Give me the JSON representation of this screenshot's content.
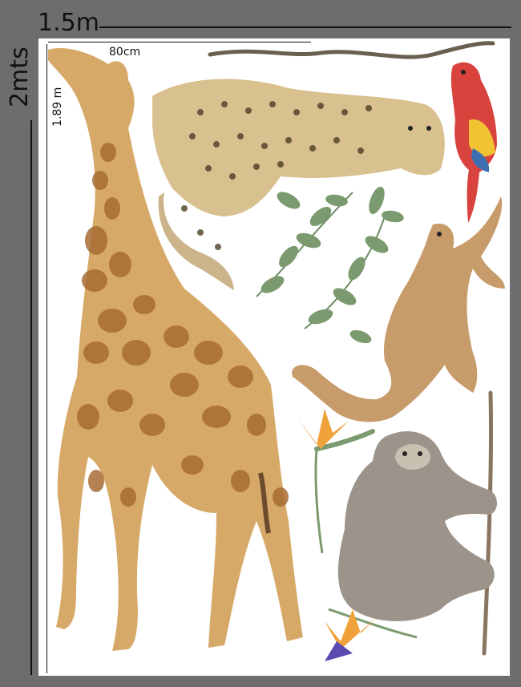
{
  "dimensions": {
    "width_label": "1.5m",
    "height_label": "2mts",
    "inner_width_label": "80cm",
    "inner_height_label": "1.89 m"
  },
  "colors": {
    "background": "#6d6d6d",
    "sheet": "#ffffff",
    "giraffe": "#d7a968",
    "cheetah": "#d8c08f",
    "monkey": "#c79b6a",
    "sloth": "#9c948a",
    "leaf": "#7b9a6f",
    "parrot": "#d9433e"
  },
  "illustrations": [
    {
      "name": "giraffe"
    },
    {
      "name": "cheetah"
    },
    {
      "name": "parrot"
    },
    {
      "name": "monkey"
    },
    {
      "name": "sloth"
    },
    {
      "name": "leaf-branches"
    },
    {
      "name": "bird-of-paradise-flowers"
    },
    {
      "name": "vine-branch"
    }
  ]
}
